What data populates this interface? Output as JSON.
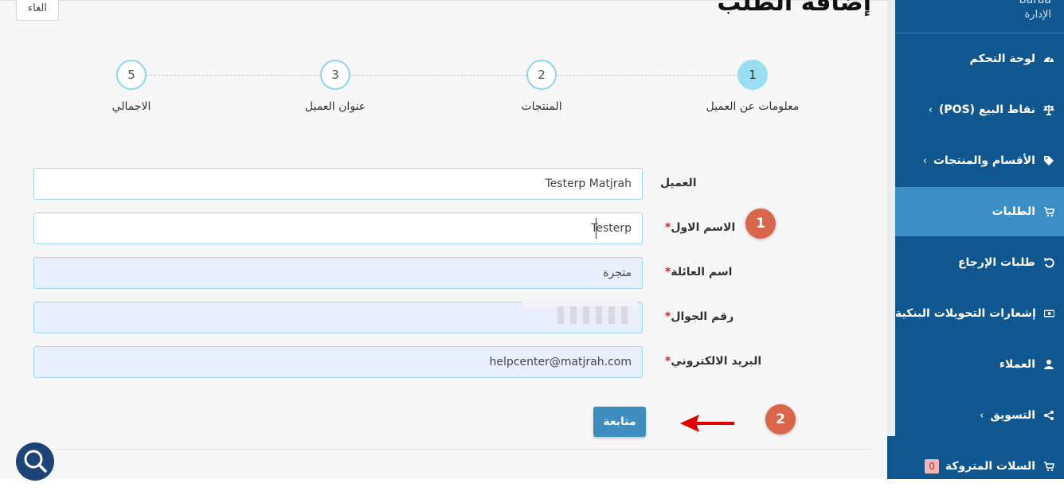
{
  "header": {
    "title": "إضافة الطلب",
    "cancel_label": "الغاء"
  },
  "stepper": {
    "steps": [
      {
        "number": "1",
        "label": "معلومات عن العميل"
      },
      {
        "number": "2",
        "label": "المنتجات"
      },
      {
        "number": "3",
        "label": "عنوان العميل"
      },
      {
        "number": "5",
        "label": "الاجمالي"
      }
    ],
    "active_step": 1
  },
  "form": {
    "customer_label": "العميل",
    "customer_value": "Testerp Matjrah",
    "first_name_label": "الاسم الاول",
    "first_name_value": "Testerp",
    "last_name_label": "اسم العائلة",
    "last_name_value": "متجرة",
    "phone_label": "رقم الجوال",
    "email_label": "البريد الالكتروني",
    "email_value": "helpcenter@matjrah.com",
    "required_mark": "*",
    "continue_label": "متابعة"
  },
  "annotations": {
    "one": "1",
    "two": "2"
  },
  "sidebar": {
    "user_name": "baraa",
    "user_role": "الإدارة",
    "items": [
      {
        "label": "لوحة التحكم",
        "icon": "dashboard-icon"
      },
      {
        "label": "نقاط البيع (POS)",
        "icon": "balance-scale-icon",
        "chevron": "‹"
      },
      {
        "label": "الأقسام والمنتجات",
        "icon": "tag-icon",
        "chevron": "‹"
      },
      {
        "label": "الطلبات",
        "icon": "cart-icon",
        "active": true
      },
      {
        "label": "طلبات الإرجاع",
        "icon": "undo-icon"
      },
      {
        "label": "إشعارات التحويلات البنكية",
        "icon": "money-icon"
      },
      {
        "label": "العملاء",
        "icon": "user-icon"
      },
      {
        "label": "التسويق",
        "icon": "share-icon",
        "chevron": "‹"
      },
      {
        "label": "السلات المتروكة",
        "icon": "cart-icon",
        "badge": "0"
      }
    ]
  },
  "colors": {
    "sidebar_bg": "#11578f",
    "sidebar_active": "#3b8ec6",
    "accent_button": "#3d8ebf",
    "step_active": "#98dff2",
    "annotation": "#d9654b",
    "arrow": "#e00000"
  }
}
